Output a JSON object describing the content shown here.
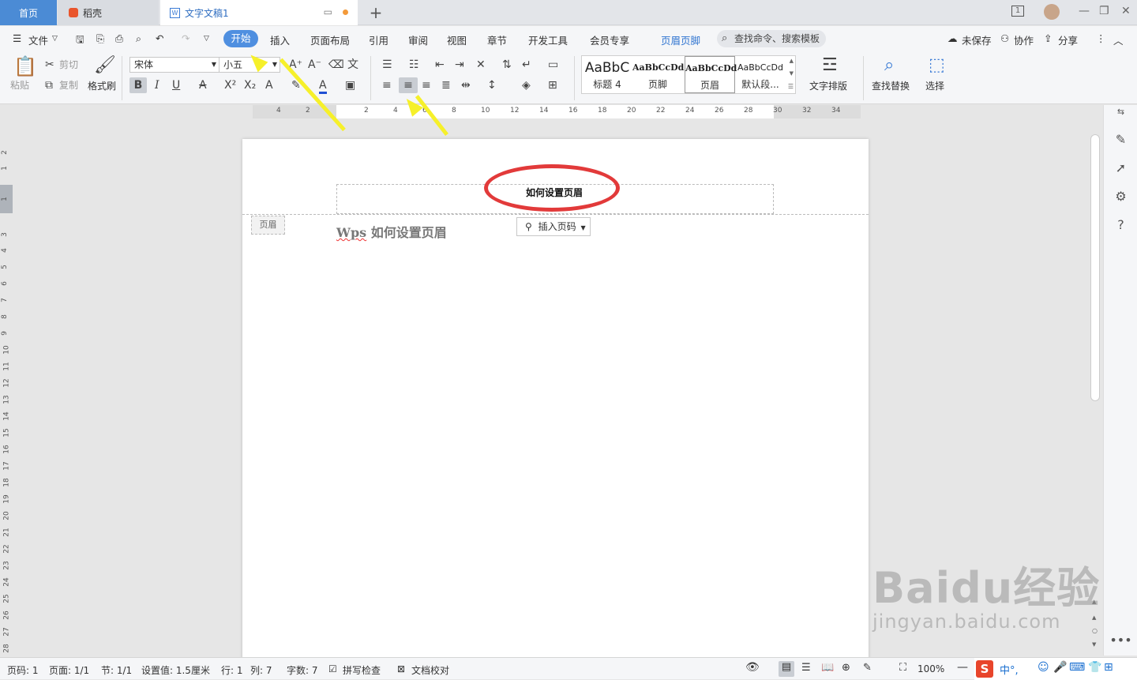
{
  "tabs": {
    "home": "首页",
    "daoke": "稻壳",
    "doc": "文字文稿1",
    "new": "+"
  },
  "window": {
    "page_num": "1"
  },
  "menubar": {
    "file": "文件",
    "items": [
      "开始",
      "插入",
      "页面布局",
      "引用",
      "审阅",
      "视图",
      "章节",
      "开发工具",
      "会员专享",
      "页眉页脚"
    ],
    "search": "查找命令、搜索模板",
    "unsaved": "未保存",
    "collab": "协作",
    "share": "分享"
  },
  "ribbon": {
    "paste": "粘贴",
    "cut": "剪切",
    "copy": "复制",
    "format_painter": "格式刷",
    "font_name": "宋体",
    "font_size": "小五",
    "styles": [
      {
        "preview": "AaBbC",
        "name": "标题 4"
      },
      {
        "preview": "AaBbCcDd",
        "name": "页脚"
      },
      {
        "preview": "AaBbCcDd",
        "name": "页眉"
      },
      {
        "preview": "AaBbCcDd",
        "name": "默认段..."
      }
    ],
    "text_layout": "文字排版",
    "find_replace": "查找替换",
    "select": "选择"
  },
  "ruler": {
    "h_ticks": [
      "4",
      "2",
      "2",
      "4",
      "6",
      "8",
      "10",
      "12",
      "14",
      "16",
      "18",
      "20",
      "22",
      "24",
      "26",
      "28",
      "30",
      "32",
      "34"
    ],
    "v_ticks": [
      "2",
      "1",
      "1",
      "3",
      "4",
      "5",
      "6",
      "7",
      "8",
      "9",
      "10",
      "11",
      "12",
      "13",
      "14",
      "15",
      "16",
      "17",
      "18",
      "19",
      "20",
      "21",
      "22",
      "23",
      "24",
      "25",
      "26",
      "27",
      "28"
    ]
  },
  "document": {
    "header_text": "如何设置页眉",
    "header_tag": "页眉",
    "insert_page_num": "插入页码",
    "body_prefix": "Wps",
    "body_rest": " 如何设置页眉"
  },
  "status": {
    "page_code": "页码: 1",
    "pages": "页面: 1/1",
    "section": "节: 1/1",
    "setting": "设置值: 1.5厘米",
    "row": "行: 1",
    "col": "列: 7",
    "words": "字数: 7",
    "spell": "拼写检查",
    "proof": "文档校对",
    "zoom": "100%"
  },
  "watermark": {
    "line1": "Baidu经验",
    "line2": "jingyan.baidu.com"
  },
  "colors": {
    "accent": "#4f8fe0",
    "highlight_oval": "#e23a3a",
    "arrow": "#f6f02a"
  }
}
